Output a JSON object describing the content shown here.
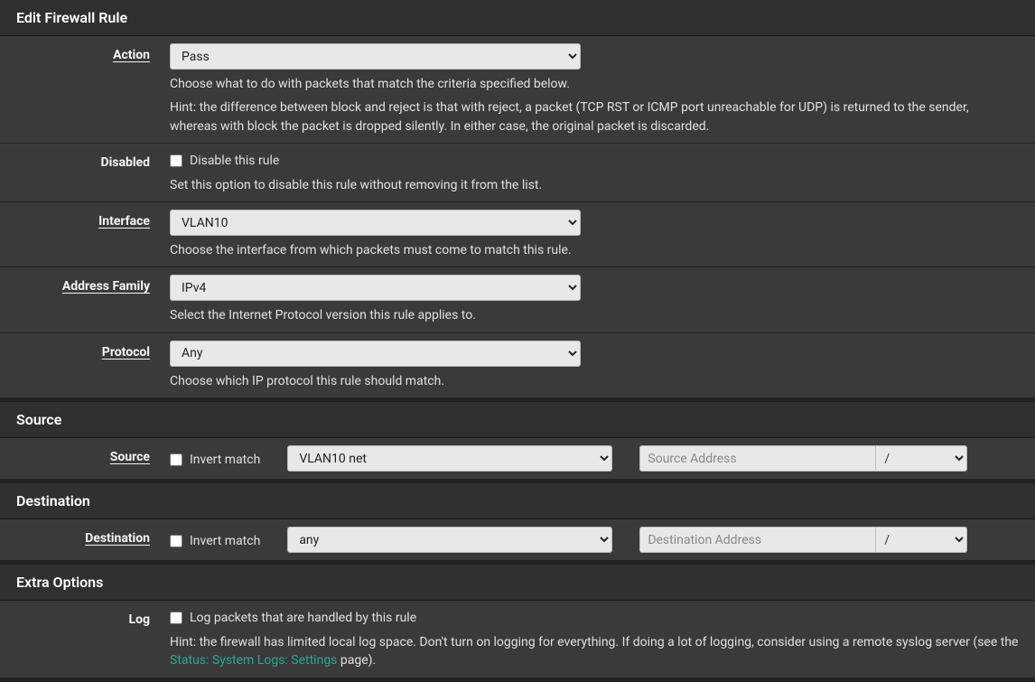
{
  "panels": {
    "edit": {
      "title": "Edit Firewall Rule",
      "action": {
        "label": "Action",
        "value": "Pass",
        "help1": "Choose what to do with packets that match the criteria specified below.",
        "help2": "Hint: the difference between block and reject is that with reject, a packet (TCP RST or ICMP port unreachable for UDP) is returned to the sender, whereas with block the packet is dropped silently. In either case, the original packet is discarded."
      },
      "disabled": {
        "label": "Disabled",
        "cblabel": "Disable this rule",
        "help": "Set this option to disable this rule without removing it from the list."
      },
      "interface": {
        "label": "Interface",
        "value": "VLAN10",
        "help": "Choose the interface from which packets must come to match this rule."
      },
      "af": {
        "label": "Address Family",
        "value": "IPv4",
        "help": "Select the Internet Protocol version this rule applies to."
      },
      "protocol": {
        "label": "Protocol",
        "value": "Any",
        "help": "Choose which IP protocol this rule should match."
      }
    },
    "source": {
      "title": "Source",
      "label": "Source",
      "invert": "Invert match",
      "type": "VLAN10 net",
      "addrPlaceholder": "Source Address",
      "slash": "/"
    },
    "destination": {
      "title": "Destination",
      "label": "Destination",
      "invert": "Invert match",
      "type": "any",
      "addrPlaceholder": "Destination Address",
      "slash": "/"
    },
    "extra": {
      "title": "Extra Options",
      "log": {
        "label": "Log",
        "cblabel": "Log packets that are handled by this rule",
        "hint_pre": "Hint: the firewall has limited local log space. Don't turn on logging for everything. If doing a lot of logging, consider using a remote syslog server (see the ",
        "hint_link": "Status: System Logs: Settings",
        "hint_post": " page)."
      }
    }
  }
}
